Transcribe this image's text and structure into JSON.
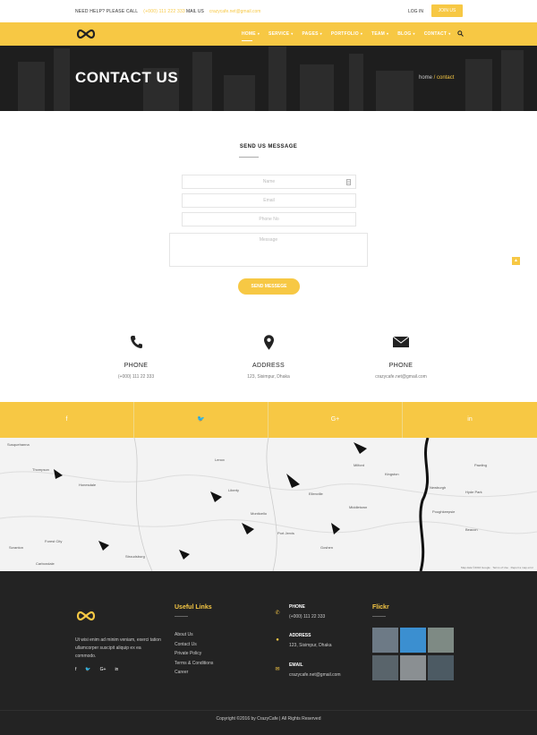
{
  "topbar": {
    "help_label": "NEED HELP? PLEASE CALL",
    "help_phone": "(+000) 111 222 333",
    "mail_label": "MAIL US",
    "mail_value": "crazycafe.net@gmail.com",
    "login": "LOG IN",
    "join": "JOIN US"
  },
  "nav": {
    "items": [
      {
        "label": "HOME"
      },
      {
        "label": "SERVICE"
      },
      {
        "label": "PAGES"
      },
      {
        "label": "PORTFOLIO"
      },
      {
        "label": "TEAM"
      },
      {
        "label": "BLOG"
      },
      {
        "label": "CONTACT"
      }
    ],
    "chevron": "▾"
  },
  "hero": {
    "title": "CONTACT US",
    "crumb_home": "home",
    "crumb_sep": " / ",
    "crumb_current": "contact"
  },
  "form": {
    "title": "SEND US MESSAGE",
    "name_placeholder": "Name",
    "email_placeholder": "Email",
    "phone_placeholder": "Phone No",
    "message_placeholder": "Message",
    "send_label": "SEND MESSEGE"
  },
  "contact_cards": [
    {
      "icon": "phone-icon",
      "title": "PHONE",
      "value": "(+000) 111 22 333"
    },
    {
      "icon": "map-marker-icon",
      "title": "ADDRESS",
      "value": "123, Sisimpur, Dhaka"
    },
    {
      "icon": "envelope-icon",
      "title": "PHONE",
      "value": "crazycafe.net@gmail.com"
    }
  ],
  "social": [
    {
      "icon": "facebook-icon",
      "glyph": "f"
    },
    {
      "icon": "twitter-icon",
      "glyph": "🐦"
    },
    {
      "icon": "google-plus-icon",
      "glyph": "G+"
    },
    {
      "icon": "linkedin-icon",
      "glyph": "in"
    }
  ],
  "map": {
    "labels": [
      "Susquehanna",
      "Lenox",
      "Thompson",
      "Milford",
      "Honesdale",
      "Newburgh",
      "Poughkeepsie",
      "Middletown",
      "Kingston",
      "Carbondale",
      "Forest City",
      "Scranton",
      "Stroudsburg",
      "Port Jervis",
      "Goshen",
      "Pawling",
      "Beacon",
      "Hyde Park",
      "Ellenville",
      "Liberty",
      "Monticello"
    ],
    "attribution": "Map data ©2016 Google  ·  Terms of Use  ·  Report a map error"
  },
  "footer": {
    "about": "Ut wisi enim ad minim veniam, exerci tation ullamcorper suscipit aliquip ex ea commodo.",
    "social": [
      "f",
      "🐦",
      "G+",
      "in"
    ],
    "useful_title": "Useful Links",
    "links": [
      "About Us",
      "Contact Us",
      "Private Policy",
      "Terms & Conditions",
      "Career"
    ],
    "phone_title": "PHONE",
    "phone_value": "(+000) 111 22 333",
    "address_title": "ADDRESS",
    "address_value": "123, Sisimpur, Dhaka",
    "email_title": "EMAIL",
    "email_value": "crazycafe.net@gmail.com",
    "flickr_title": "Flickr",
    "copyright": "Copyright ©2016 by CrazyCafe   |   All Rights Reserved"
  },
  "colors": {
    "accent": "#f7c844",
    "dark": "#232323"
  }
}
